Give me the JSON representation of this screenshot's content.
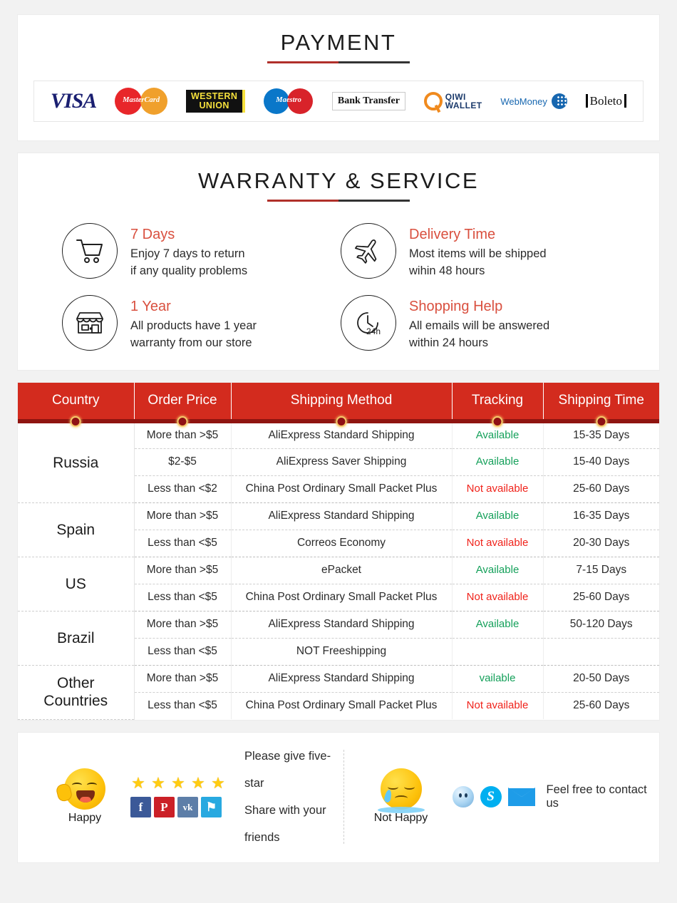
{
  "payment": {
    "title": "PAYMENT",
    "methods": [
      {
        "name": "visa",
        "label": "VISA"
      },
      {
        "name": "mastercard",
        "label": "MasterCard"
      },
      {
        "name": "western-union",
        "line1": "WESTERN",
        "line2": "UNION"
      },
      {
        "name": "maestro",
        "label": "Maestro"
      },
      {
        "name": "bank-transfer",
        "label": "Bank Transfer"
      },
      {
        "name": "qiwi-wallet",
        "line1": "QIWI",
        "line2": "WALLET"
      },
      {
        "name": "webmoney",
        "label": "WebMoney"
      },
      {
        "name": "boleto",
        "label": "Boleto"
      }
    ]
  },
  "warranty": {
    "title": "WARRANTY & SERVICE",
    "items": [
      {
        "icon": "shopping-cart-icon",
        "heading": "7 Days",
        "line1": "Enjoy 7 days to return",
        "line2": "if any quality problems"
      },
      {
        "icon": "airplane-icon",
        "heading": "Delivery Time",
        "line1": "Most items will be shipped",
        "line2": "wihin 48 hours"
      },
      {
        "icon": "store-icon",
        "heading": "1 Year",
        "line1": "All products have 1 year",
        "line2": "warranty from our store"
      },
      {
        "icon": "clock-24h-icon",
        "heading": "Shopping Help",
        "line1": "All emails will be answered",
        "line2": "within 24 hours"
      }
    ]
  },
  "shipping_table": {
    "headers": [
      "Country",
      "Order Price",
      "Shipping Method",
      "Tracking",
      "Shipping Time"
    ],
    "groups": [
      {
        "country": "Russia",
        "rows": [
          {
            "price": "More than >$5",
            "method": "AliExpress Standard Shipping",
            "tracking": "Available",
            "tracking_state": "available",
            "time": "15-35 Days"
          },
          {
            "price": "$2-$5",
            "method": "AliExpress Saver Shipping",
            "tracking": "Available",
            "tracking_state": "available",
            "time": "15-40 Days"
          },
          {
            "price": "Less than <$2",
            "method": "China Post Ordinary Small Packet Plus",
            "tracking": "Not available",
            "tracking_state": "not-available",
            "time": "25-60 Days"
          }
        ]
      },
      {
        "country": "Spain",
        "rows": [
          {
            "price": "More than >$5",
            "method": "AliExpress Standard Shipping",
            "tracking": "Available",
            "tracking_state": "available",
            "time": "16-35 Days"
          },
          {
            "price": "Less than <$5",
            "method": "Correos Economy",
            "tracking": "Not available",
            "tracking_state": "not-available",
            "time": "20-30 Days"
          }
        ]
      },
      {
        "country": "US",
        "rows": [
          {
            "price": "More than >$5",
            "method": "ePacket",
            "tracking": "Available",
            "tracking_state": "available",
            "time": "7-15 Days"
          },
          {
            "price": "Less than <$5",
            "method": "China Post Ordinary Small Packet Plus",
            "tracking": "Not available",
            "tracking_state": "not-available",
            "time": "25-60 Days"
          }
        ]
      },
      {
        "country": "Brazil",
        "rows": [
          {
            "price": "More than >$5",
            "method": "AliExpress Standard Shipping",
            "tracking": "Available",
            "tracking_state": "available",
            "time": "50-120 Days"
          },
          {
            "price": "Less than <$5",
            "method": "NOT Freeshipping",
            "tracking": "",
            "tracking_state": "none",
            "time": ""
          }
        ]
      },
      {
        "country": "Other Countries",
        "country_line1": "Other",
        "country_line2": "Countries",
        "rows": [
          {
            "price": "More than >$5",
            "method": "AliExpress Standard Shipping",
            "tracking": "vailable",
            "tracking_state": "available",
            "time": "20-50 Days"
          },
          {
            "price": "Less than <$5",
            "method": "China Post Ordinary Small Packet Plus",
            "tracking": "Not available",
            "tracking_state": "not-available",
            "time": "25-60 Days"
          }
        ]
      }
    ]
  },
  "feedback": {
    "happy": {
      "caption": "Happy",
      "stars": 5,
      "line1": "Please give five-star",
      "line2": "Share with your friends",
      "socials": [
        {
          "name": "facebook",
          "glyph": "f",
          "color": "#3b5998"
        },
        {
          "name": "pinterest",
          "glyph": "P",
          "color": "#cb2027"
        },
        {
          "name": "vk",
          "glyph": "vk",
          "color": "#5d7ea8"
        },
        {
          "name": "twitter",
          "glyph": "⚑",
          "color": "#28a9e0"
        }
      ]
    },
    "not_happy": {
      "caption": "Not Happy",
      "contact_text": "Feel free to contact us",
      "contacts": [
        {
          "name": "qq",
          "label": "QQ"
        },
        {
          "name": "skype",
          "label": "S"
        },
        {
          "name": "email",
          "label": "Email"
        }
      ]
    }
  },
  "colors": {
    "brand_red": "#d32b1e",
    "header_border": "#8f1410",
    "accent_red": "#b0302a",
    "heading_red": "#d9503f",
    "available_green": "#14a05a",
    "not_available_red": "#f0231b",
    "page_bg": "#f2f2f2"
  }
}
